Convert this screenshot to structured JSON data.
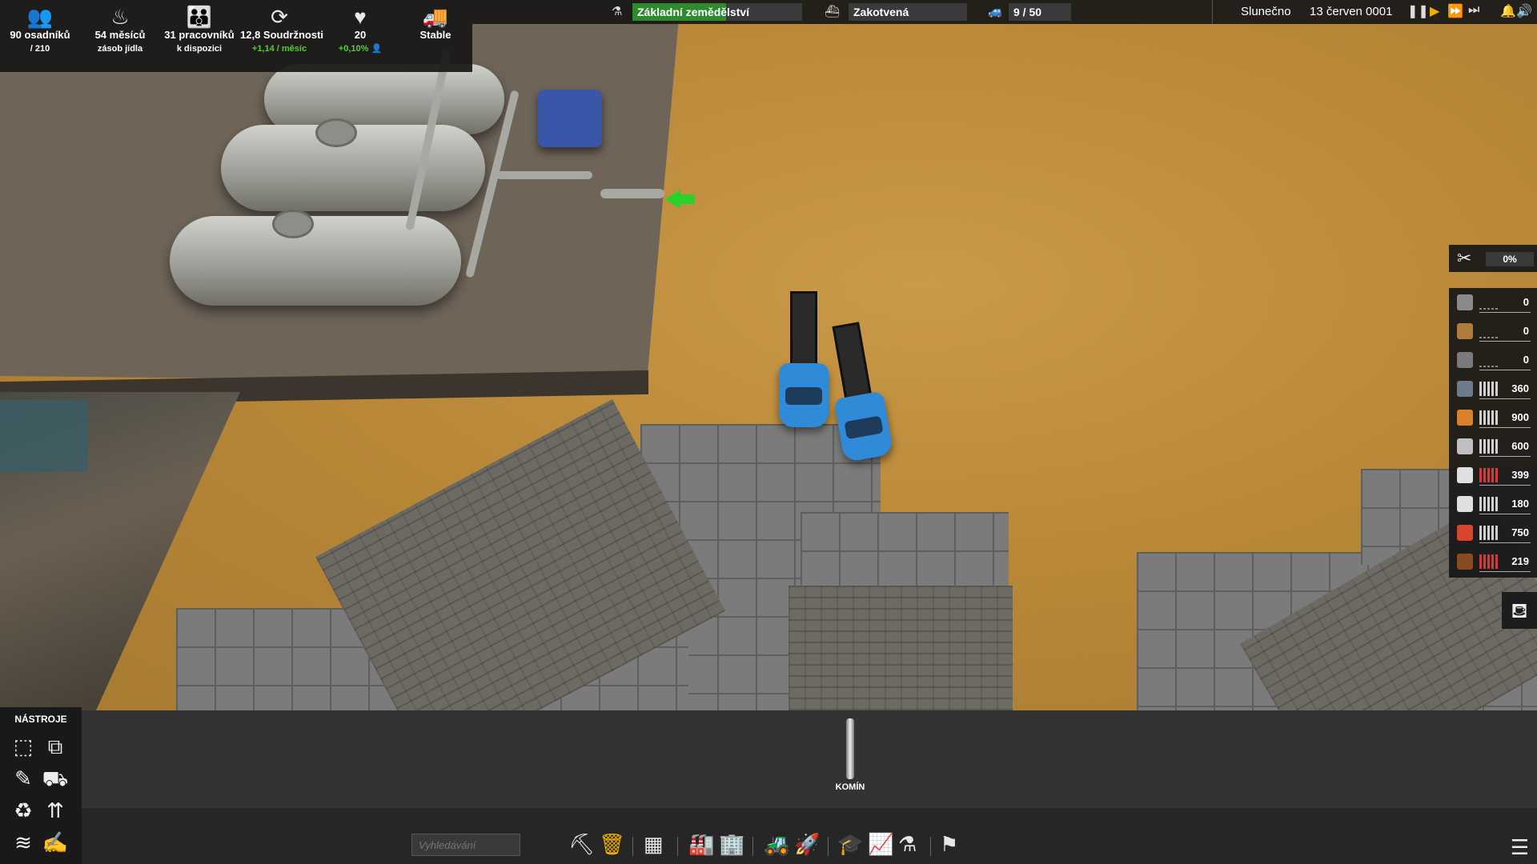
{
  "stats": {
    "settlers": {
      "icon": "people-icon",
      "line1": "90 osadníků",
      "line2": "/ 210"
    },
    "food": {
      "icon": "food-bowl-icon",
      "line1": "54 měsíců",
      "line2": "zásob jídla"
    },
    "workers": {
      "icon": "workers-icon",
      "line1": "31 pracovníků",
      "line2": "k dispozici"
    },
    "unity": {
      "icon": "unity-icon",
      "line1": "12,8 Soudržnosti",
      "line2": "+1,14 / měsíc"
    },
    "health": {
      "icon": "heart-icon",
      "line1": "20",
      "line2": "+0,10%"
    },
    "trucks": {
      "icon": "truck-icon",
      "line1": "Stable"
    }
  },
  "topbar": {
    "research": "Základní zemědělství",
    "research_progress": 0.55,
    "ship": "Zakotvená",
    "vehicles": "9 / 50",
    "weather": "Slunečno",
    "date": "13 červen 0001"
  },
  "maintenance": {
    "value": "0%"
  },
  "resources": [
    {
      "icon": "resource-1-icon",
      "value": "0",
      "fill": 0.0,
      "color": "#d0d0d0",
      "icolor": "#8a8a8a"
    },
    {
      "icon": "resource-2-icon",
      "value": "0",
      "fill": 0.0,
      "color": "#d0d0d0",
      "icolor": "#b07a3a"
    },
    {
      "icon": "resource-3-icon",
      "value": "0",
      "fill": 0.0,
      "color": "#d0d0d0",
      "icolor": "#7a7a7a"
    },
    {
      "icon": "resource-4-icon",
      "value": "360",
      "fill": 1.0,
      "color": "#d0d0d0",
      "icolor": "#6d7a8a"
    },
    {
      "icon": "resource-5-icon",
      "value": "900",
      "fill": 1.0,
      "color": "#d0d0d0",
      "icolor": "#d9822b"
    },
    {
      "icon": "resource-6-icon",
      "value": "600",
      "fill": 1.0,
      "color": "#d0d0d0",
      "icolor": "#c0c0c0"
    },
    {
      "icon": "resource-7-icon",
      "value": "399",
      "fill": 1.0,
      "color": "#d43a3a",
      "icolor": "#e0e0e0"
    },
    {
      "icon": "resource-8-icon",
      "value": "180",
      "fill": 1.0,
      "color": "#d0d0d0",
      "icolor": "#e0e0e0"
    },
    {
      "icon": "resource-9-icon",
      "value": "750",
      "fill": 1.0,
      "color": "#d0d0d0",
      "icolor": "#d8452c"
    },
    {
      "icon": "resource-10-icon",
      "value": "219",
      "fill": 1.0,
      "color": "#d43a3a",
      "icolor": "#8a4a22"
    }
  ],
  "tools": {
    "title": "NÁSTROJE"
  },
  "build_item": {
    "label": "KOMÍN"
  },
  "search": {
    "placeholder": "Vyhledávání"
  }
}
